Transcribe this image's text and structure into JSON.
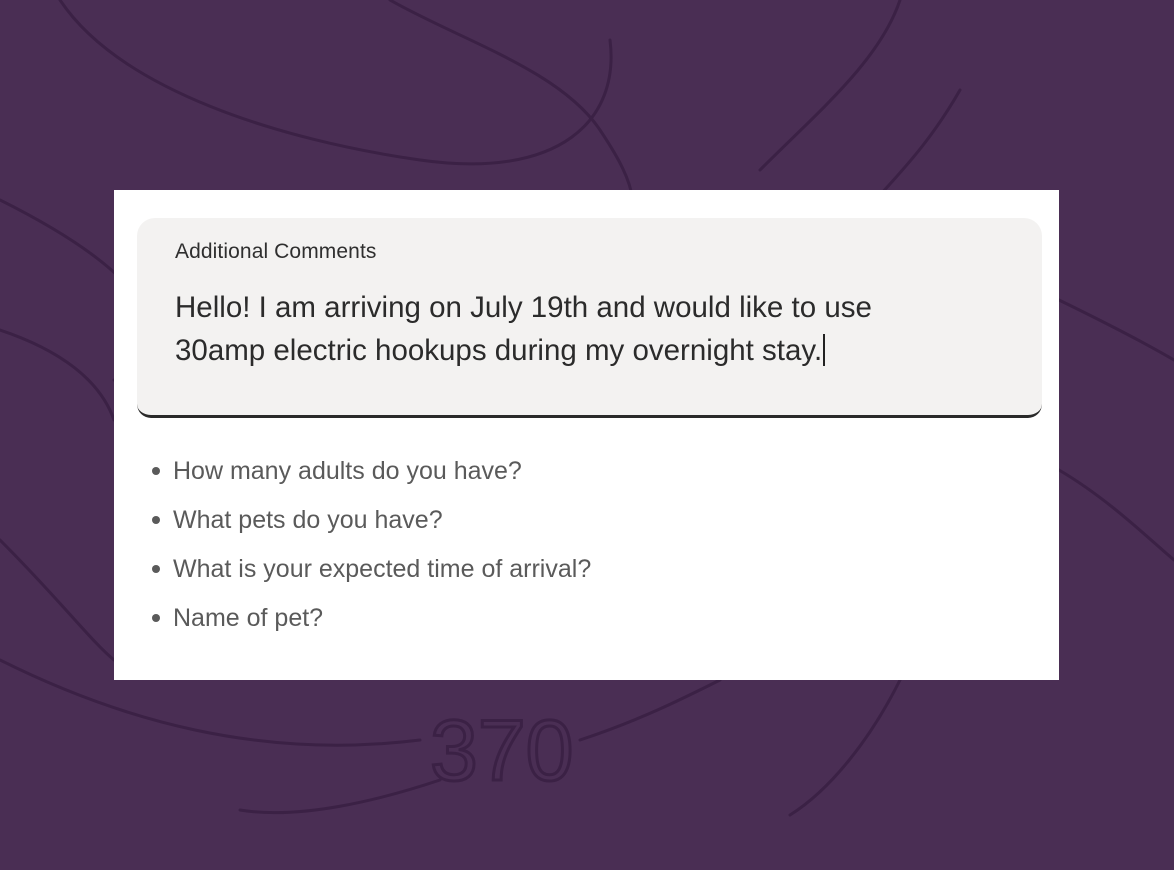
{
  "colors": {
    "background": "#4a2e54",
    "card": "#ffffff",
    "field_fill": "#f3f2f1",
    "field_underline": "#2a2a2a",
    "hint_text": "#5a5a5a"
  },
  "form": {
    "field_label": "Additional Comments",
    "field_value_line1": "Hello! I am arriving on July 19th and would like to use",
    "field_value_line2": "30amp electric hookups during my overnight stay.",
    "hints": [
      "How many adults do you have?",
      "What pets do you have?",
      "What is your expected time of arrival?",
      "Name of pet?"
    ]
  },
  "background_art": {
    "watermark_text": "370"
  }
}
